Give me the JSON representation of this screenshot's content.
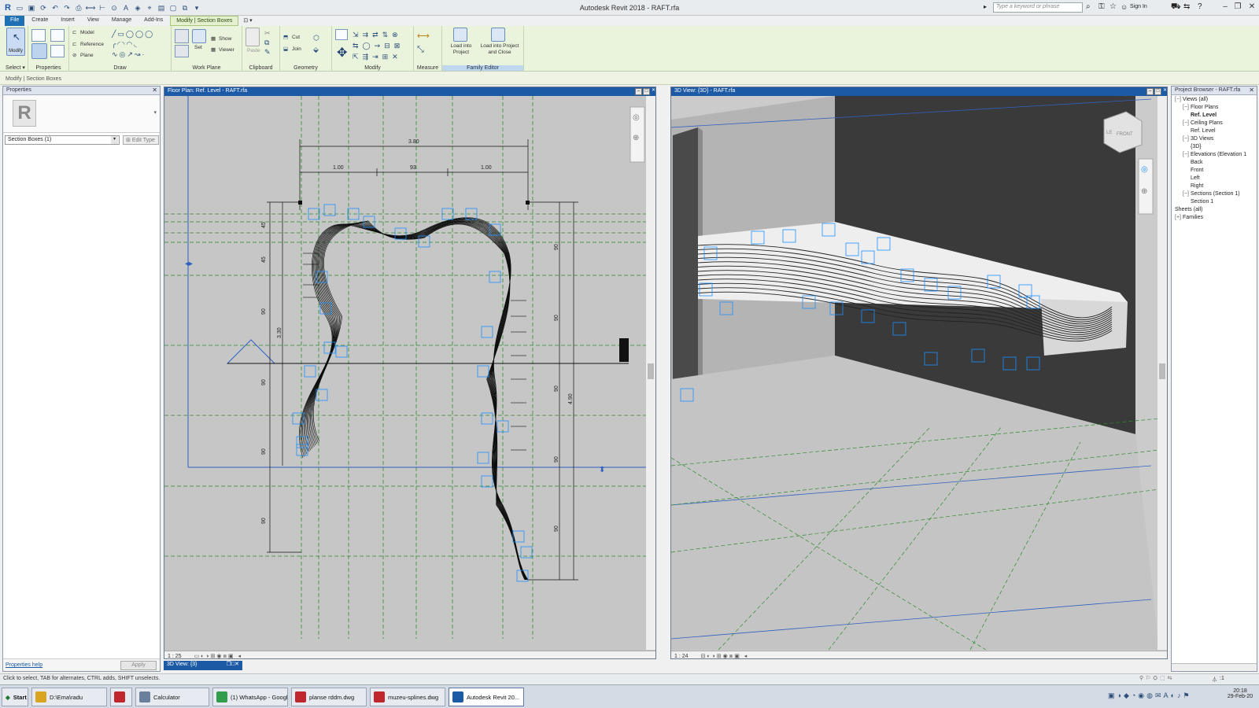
{
  "window": {
    "title": "Autodesk Revit 2018 -    RAFT.rfa",
    "search_placeholder": "Type a keyword or phrase",
    "sign_in": "Sign In"
  },
  "tabs": [
    {
      "label": "File"
    },
    {
      "label": "Create"
    },
    {
      "label": "Insert"
    },
    {
      "label": "View"
    },
    {
      "label": "Manage"
    },
    {
      "label": "Add-Ins"
    },
    {
      "label": "Modify | Section Boxes"
    }
  ],
  "ribbon": {
    "groups": {
      "select": "Select ▾",
      "properties": "Properties",
      "draw": "Draw",
      "work_plane": "Work Plane",
      "clipboard": "Clipboard",
      "geometry": "Geometry",
      "modify": "Modify",
      "measure": "Measure",
      "family_editor": "Family Editor"
    },
    "modify_button": "Modify",
    "model": "Model",
    "reference": "Reference",
    "plane": "Plane",
    "set": "Set",
    "show": "Show",
    "viewer": "Viewer",
    "paste": "Paste",
    "cut": "Cut",
    "join": "Join",
    "load_into_project": "Load into Project",
    "load_into_project_close": "Load into Project and Close"
  },
  "options_bar": "Modify | Section Boxes",
  "properties": {
    "header": "Properties",
    "type_selector": "Section Boxes (1)",
    "edit_type": "Edit Type",
    "help": "Properties help",
    "apply": "Apply"
  },
  "floor_plan": {
    "title": "Floor Plan: Ref. Level - RAFT.rfa",
    "scale": "1 : 25",
    "dimensions": {
      "top_total": "3.80",
      "top_left": "1.00",
      "top_mid": "93",
      "top_right": "1.00",
      "left_a": "45",
      "left_b": "45",
      "left_c": "90",
      "left_total": "3.30",
      "left_d": "90",
      "left_e": "90",
      "left_f": "90",
      "right_a": "90",
      "right_b": "90",
      "right_total": "4.90",
      "right_c": "90",
      "right_d": "90",
      "right_e": "90"
    }
  },
  "view_3d": {
    "title": "3D View: {3D} - RAFT.rfa",
    "scale": "1 : 24",
    "viewcube": "FRONT",
    "viewcube_left": "LE"
  },
  "minimized_view": {
    "title": "3D View: {3}"
  },
  "project_browser": {
    "header": "Project Browser - RAFT.rfa",
    "items": [
      {
        "label": "Views (all)",
        "level": 0,
        "toggle": "−"
      },
      {
        "label": "Floor Plans",
        "level": 1,
        "toggle": "−"
      },
      {
        "label": "Ref. Level",
        "level": 2,
        "toggle": "",
        "bold": true
      },
      {
        "label": "Ceiling Plans",
        "level": 1,
        "toggle": "−"
      },
      {
        "label": "Ref. Level",
        "level": 2,
        "toggle": ""
      },
      {
        "label": "3D Views",
        "level": 1,
        "toggle": "−"
      },
      {
        "label": "{3D}",
        "level": 2,
        "toggle": ""
      },
      {
        "label": "Elevations (Elevation 1",
        "level": 1,
        "toggle": "−"
      },
      {
        "label": "Back",
        "level": 2,
        "toggle": ""
      },
      {
        "label": "Front",
        "level": 2,
        "toggle": ""
      },
      {
        "label": "Left",
        "level": 2,
        "toggle": ""
      },
      {
        "label": "Right",
        "level": 2,
        "toggle": ""
      },
      {
        "label": "Sections (Section 1)",
        "level": 1,
        "toggle": "−"
      },
      {
        "label": "Section 1",
        "level": 2,
        "toggle": ""
      },
      {
        "label": "Sheets (all)",
        "level": 0,
        "toggle": ""
      },
      {
        "label": "Families",
        "level": 0,
        "toggle": "+"
      }
    ]
  },
  "status_bar": {
    "text": "Click to select, TAB for alternates, CTRL adds, SHIFT unselects.",
    "filter_count": ":1"
  },
  "taskbar": {
    "start": "Start",
    "items": [
      {
        "label": "D:\\Ema\\radu",
        "icon_color": "#d9a520"
      },
      {
        "label": "",
        "icon_color": "#c0262d"
      },
      {
        "label": "Calculator",
        "icon_color": "#6a7f9c"
      },
      {
        "label": "(1) WhatsApp - Googl...",
        "icon_color": "#2f9d4c"
      },
      {
        "label": "planse rddm.dwg",
        "icon_color": "#c0262d"
      },
      {
        "label": "muzeu-splines.dwg",
        "icon_color": "#c0262d"
      },
      {
        "label": "Autodesk Revit 20...",
        "icon_color": "#1c5aa6"
      }
    ],
    "time": "20:18",
    "date": "29-Feb-20"
  },
  "colors": {
    "accent": "#1f6fb5",
    "ribbon_bg": "#eaf3dc",
    "selection": "#1e90ff",
    "grid": "#2e8b2e"
  }
}
